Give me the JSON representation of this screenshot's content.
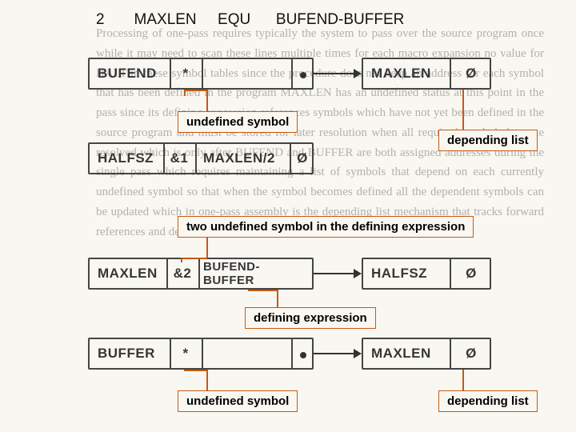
{
  "header": "2       MAXLEN     EQU      BUFEND-BUFFER",
  "rows": {
    "r1a_c1": "BUFEND",
    "r1a_c2": "*",
    "r1b_c1": "MAXLEN",
    "r1b_c2": "Ø",
    "r2_c1": "HALFSZ",
    "r2_c2": "&1",
    "r2_c3": "MAXLEN/2",
    "r2_c4": "Ø",
    "r3a_c1": "MAXLEN",
    "r3a_c2": "&2",
    "r3a_c3": "BUFEND-BUFFER",
    "r3b_c1": "HALFSZ",
    "r3b_c2": "Ø",
    "r4a_c1": "BUFFER",
    "r4a_c2": "*",
    "r4b_c1": "MAXLEN",
    "r4b_c2": "Ø"
  },
  "labels": {
    "und1": "undefined symbol",
    "dep1": "depending list",
    "two": "two undefined symbol in the defining expression",
    "def": "defining expression",
    "und2": "undefined symbol",
    "dep2": "depending list"
  },
  "bgtext": "Processing of one-pass requires typically the system to pass over the source program once while it may need to scan these lines multiple times for each macro expansion no value for HALT in these symbol tables since the procedure does not keep an address for each symbol that has been defined in the program MAXLEN has an undefined status at this point in the pass since its defining expression references symbols which have not yet been defined in the source program and must be stored for later resolution when all required symbols become resolved which is only after BUFEND and BUFFER are both assigned addresses during the single pass which requires maintaining a list of symbols that depend on each currently undefined symbol so that when the symbol becomes defined all the dependent symbols can be updated which in one-pass assembly is the depending list mechanism that tracks forward references and defining expressions that contain undefined symbols."
}
